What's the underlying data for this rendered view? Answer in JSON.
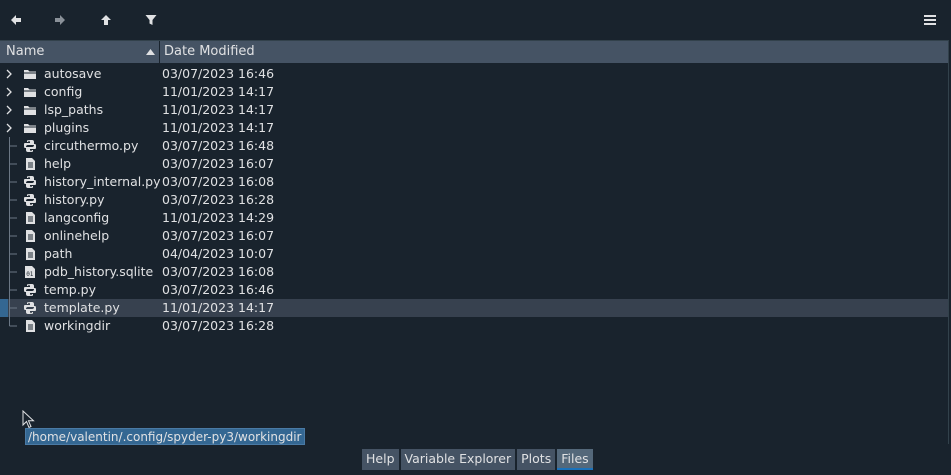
{
  "toolbar": {
    "back": "arrow-left-icon",
    "forward": "arrow-right-icon",
    "up": "arrow-up-icon",
    "filter": "filter-icon",
    "menu": "hamburger-menu-icon"
  },
  "columns": {
    "name": "Name",
    "date": "Date Modified"
  },
  "rows": [
    {
      "name": "autosave",
      "date": "03/07/2023 16:46",
      "kind": "folder",
      "icon": "folder-icon"
    },
    {
      "name": "config",
      "date": "11/01/2023 14:17",
      "kind": "folder",
      "icon": "folder-icon"
    },
    {
      "name": "lsp_paths",
      "date": "11/01/2023 14:17",
      "kind": "folder",
      "icon": "folder-icon"
    },
    {
      "name": "plugins",
      "date": "11/01/2023 14:17",
      "kind": "folder",
      "icon": "folder-icon"
    },
    {
      "name": "circuthermo.py",
      "date": "03/07/2023 16:48",
      "kind": "python",
      "icon": "python-file-icon"
    },
    {
      "name": "help",
      "date": "03/07/2023 16:07",
      "kind": "file",
      "icon": "text-file-icon"
    },
    {
      "name": "history_internal.py",
      "date": "03/07/2023 16:08",
      "kind": "python",
      "icon": "python-file-icon"
    },
    {
      "name": "history.py",
      "date": "03/07/2023 16:28",
      "kind": "python",
      "icon": "python-file-icon"
    },
    {
      "name": "langconfig",
      "date": "11/01/2023 14:29",
      "kind": "file",
      "icon": "text-file-icon"
    },
    {
      "name": "onlinehelp",
      "date": "03/07/2023 16:07",
      "kind": "file",
      "icon": "text-file-icon"
    },
    {
      "name": "path",
      "date": "04/04/2023 10:07",
      "kind": "file",
      "icon": "text-file-icon"
    },
    {
      "name": "pdb_history.sqlite",
      "date": "03/07/2023 16:08",
      "kind": "binary",
      "icon": "binary-file-icon"
    },
    {
      "name": "temp.py",
      "date": "03/07/2023 16:46",
      "kind": "python",
      "icon": "python-file-icon"
    },
    {
      "name": "template.py",
      "date": "11/01/2023 14:17",
      "kind": "python",
      "icon": "python-file-icon",
      "selected": true
    },
    {
      "name": "workingdir",
      "date": "03/07/2023 16:28",
      "kind": "file",
      "icon": "text-file-icon"
    }
  ],
  "tooltip": "/home/valentin/.config/spyder-py3/workingdir",
  "tabs": [
    {
      "label": "Help",
      "active": false
    },
    {
      "label": "Variable Explorer",
      "active": false
    },
    {
      "label": "Plots",
      "active": false
    },
    {
      "label": "Files",
      "active": true
    }
  ],
  "colors": {
    "background": "#19232d",
    "header": "#455364",
    "selection": "#37414f",
    "accent": "#346792"
  }
}
